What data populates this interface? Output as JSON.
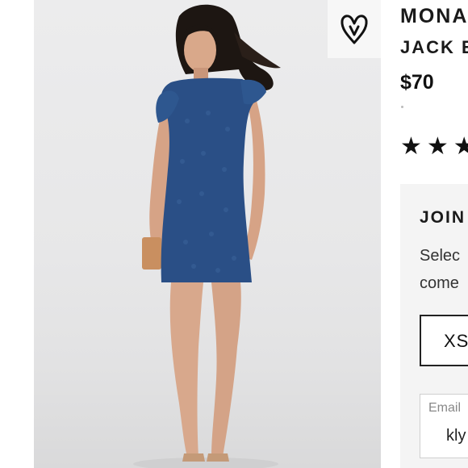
{
  "product": {
    "brand": "MONA",
    "subtitle": "JACK E",
    "price": "$70",
    "rating_stars": "★★★",
    "wishlist_icon": "heart-outline-icon"
  },
  "promo": {
    "title": "JOIN",
    "text_line1": "Selec",
    "text_line2": "come",
    "size_option": "XS",
    "email_label": "Email",
    "email_value": "kly"
  },
  "colors": {
    "dress": "#2a4f86",
    "background": "#e8e8e9",
    "panel": "#f4f4f4"
  }
}
